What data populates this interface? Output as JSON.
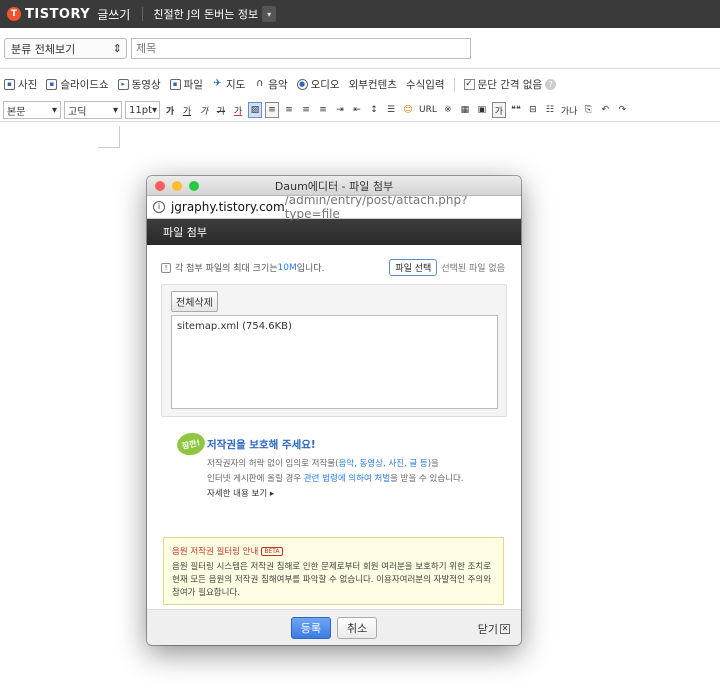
{
  "topbar": {
    "logo_mark": "T",
    "logo": "TISTORY",
    "title": "글쓰기",
    "blog_name": "친절한 J의 돈버는 정보",
    "blog_dropdown": "▾"
  },
  "editor": {
    "category": "분류 전체보기",
    "category_arrow": "⇕",
    "title_placeholder": "제목",
    "attach_items": [
      "사진",
      "슬라이드쇼",
      "동영상",
      "파일",
      "지도",
      "음악",
      "오디오",
      "외부컨텐츠",
      "수식입력"
    ],
    "paragraph_spacing_label": "문단 간격 없음",
    "paragraph_spacing_checked": "✓",
    "help": "?",
    "style_select": "본문",
    "font_select": "고딕",
    "size_select": "11pt",
    "format_buttons": [
      "가",
      "가",
      "가",
      "가",
      "가",
      "≡",
      "≡",
      "≡",
      "≡",
      "⇥",
      "⇤",
      "↕",
      "☰",
      "☺",
      "URL",
      "※",
      "▦",
      "▣",
      "가",
      "❝❝",
      "⊟",
      "☷",
      "가나",
      "⎘",
      "↶",
      "↷"
    ]
  },
  "dialog": {
    "window_title": "Daum에디터 - 파일 첨부",
    "url_host": "jgraphy.tistory.com",
    "url_path": "/admin/entry/post/attach.php?type=file",
    "header": "파일 첨부",
    "limit_prefix": "각 첨부 파일의 최대 크기는 ",
    "limit_value": "10M",
    "limit_suffix": " 입니다.",
    "pick_button": "파일 선택",
    "no_file": "선택된 파일 없음",
    "delete_all": "전체삭제",
    "files": [
      "sitemap.xml (754.6KB)"
    ],
    "copyright": {
      "stamp": "잠깐!",
      "title": "저작권을 보호해 주세요!",
      "line1_a": "저작권자의 허락 없이 임의로 저작물(",
      "line1_hl": "음악, 동영상, 사진, 글 등",
      "line1_b": ")을",
      "line2_a": "인터넷 게시판에 올릴 경우 ",
      "line2_hl": "관련 법령에 의하여 처벌",
      "line2_b": "을 받을 수 있습니다.",
      "more": "자세한 내용 보기 ▸"
    },
    "notice": {
      "title": "음원 저작권 필터링 안내",
      "badge": "BETA",
      "text": "음원 필터링 시스템은 저작권 침해로 인한 문제로부터 회원 여러분을 보호하기 위한 조치로 현재 모든 음원의 저작권 침해여부를 파악할 수 없습니다. 이용자여러분의 자발적인 주의와 참여가 필요합니다."
    },
    "register": "등록",
    "cancel": "취소",
    "close": "닫기",
    "close_x": "✕"
  }
}
